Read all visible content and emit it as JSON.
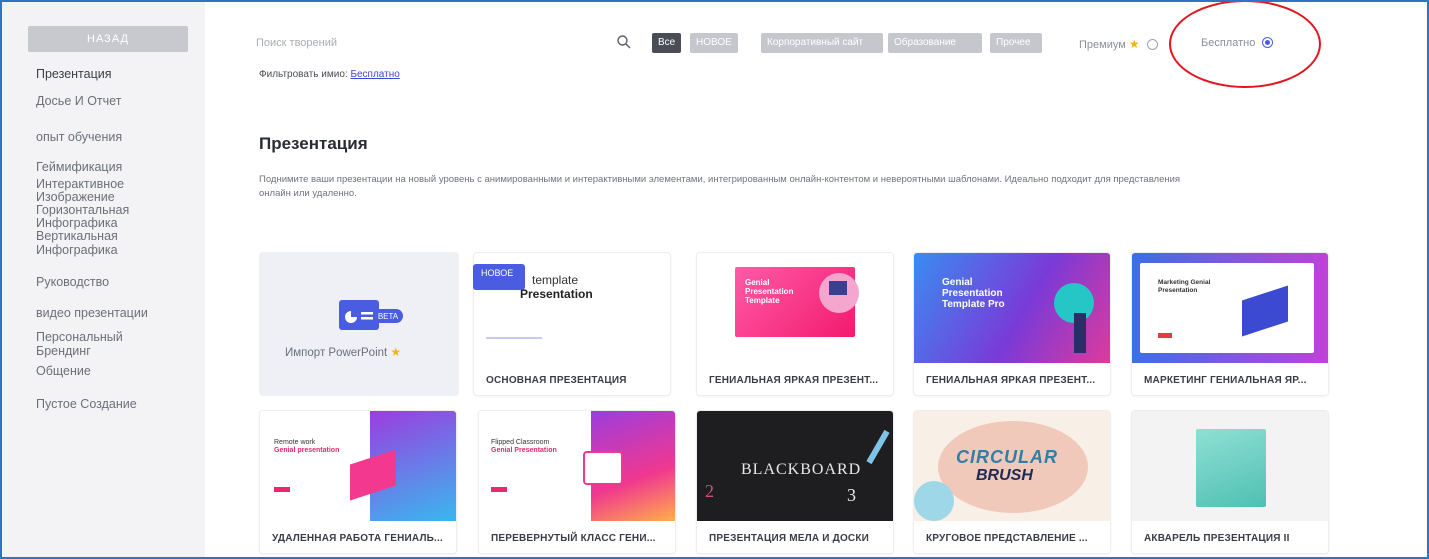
{
  "sidebar": {
    "back_label": "НАЗАД",
    "items": [
      "Презентация",
      "Досье И Отчет",
      "опыт обучения",
      "Геймификация",
      "Интерактивное",
      "Изображение",
      "Горизонтальная",
      "Инфографика",
      "Вертикальная",
      "Инфографика",
      "Руководство",
      "видео презентации",
      "Персональный",
      "Брендинг",
      "Общение",
      "Пустое Создание"
    ]
  },
  "header": {
    "search_placeholder": "Поиск творений",
    "tags": [
      "Все",
      "НОВОЕ",
      "Корпоративный сайт",
      "Образование",
      "Прочее"
    ],
    "premium_label": "Премиум",
    "free_label": "Бесплатно"
  },
  "filter": {
    "prefix": "Фильтровать имио:",
    "value": "Бесплатно"
  },
  "section": {
    "title": "Презентация",
    "description_line1": "Поднимите ваши презентации на новый уровень с анимированными и интерактивными элементами, интегрированным онлайн-контентом и невероятными шаблонами. Идеально подходит для представления",
    "description_line2": "онлайн или удаленно."
  },
  "import_card": {
    "label": "Импорт PowerPoint",
    "beta": "BETA"
  },
  "new_badge": "НОВОЕ",
  "cards": [
    {
      "label": "ОСНОВНАЯ ПРЕЗЕНТАЦИЯ",
      "thumb_text": "Basic template Presentation"
    },
    {
      "label": "ГЕНИАЛЬНАЯ ЯРКАЯ ПРЕЗЕНТ...",
      "thumb_text": "Genial Presentation Template"
    },
    {
      "label": "ГЕНИАЛЬНАЯ ЯРКАЯ ПРЕЗЕНТ...",
      "thumb_text": "Genial Presentation Template Pro"
    },
    {
      "label": "МАРКЕТИНГ ГЕНИАЛЬНАЯ ЯР...",
      "thumb_text": "Marketing Genial Presentation"
    },
    {
      "label": "УДАЛЕННАЯ РАБОТА ГЕНИАЛЬ...",
      "thumb_text": "Remote work Genial presentation"
    },
    {
      "label": "ПЕРЕВЕРНУТЫЙ КЛАСС ГЕНИ...",
      "thumb_text": "Flipped Classroom Genial Presentation"
    },
    {
      "label": "ПРЕЗЕНТАЦИЯ МЕЛА И ДОСКИ",
      "thumb_text": "BLACKBOARD"
    },
    {
      "label": "КРУГОВОЕ ПРЕДСТАВЛЕНИЕ ...",
      "thumb_text": "CIRCULAR BRUSH"
    },
    {
      "label": "АКВАРЕЛЬ ПРЕЗЕНТАЦИЯ II",
      "thumb_text": ""
    }
  ],
  "colors": {
    "accent": "#4a5de0",
    "tag_active": "#4a4d55",
    "tag_inactive": "#c5c7cd",
    "annotation": "#e3141c",
    "premium_star": "#f2b70c"
  }
}
